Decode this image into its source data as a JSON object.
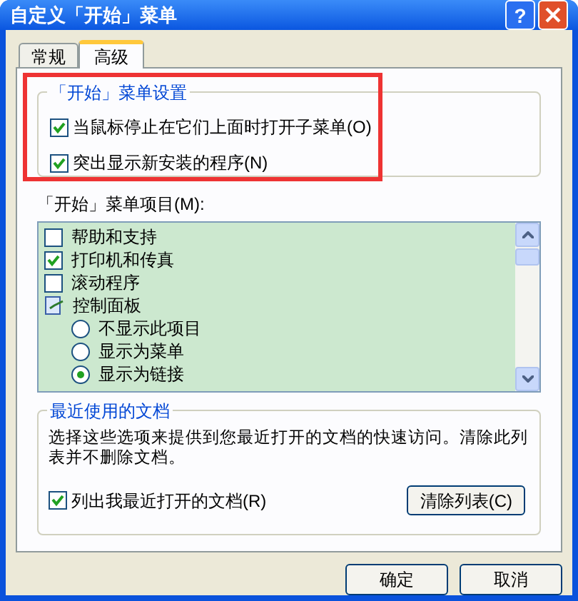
{
  "window": {
    "title": "自定义「开始」菜单",
    "help": "?"
  },
  "tabs": [
    {
      "label": "常规",
      "selected": false
    },
    {
      "label": "高级",
      "selected": true
    }
  ],
  "start_menu_settings": {
    "title": "「开始」菜单设置",
    "options": [
      {
        "label": "当鼠标停止在它们上面时打开子菜单(O)",
        "checked": true
      },
      {
        "label": "突出显示新安装的程序(N)",
        "checked": true
      }
    ]
  },
  "start_menu_items": {
    "label": "「开始」菜单项目(M):",
    "items": [
      {
        "kind": "checkbox",
        "label": "帮助和支持",
        "checked": false
      },
      {
        "kind": "checkbox",
        "label": "打印机和传真",
        "checked": true
      },
      {
        "kind": "checkbox",
        "label": "滚动程序",
        "checked": false
      },
      {
        "kind": "folder",
        "label": "控制面板",
        "children": [
          {
            "kind": "radio",
            "label": "不显示此项目",
            "selected": false
          },
          {
            "kind": "radio",
            "label": "显示为菜单",
            "selected": false
          },
          {
            "kind": "radio",
            "label": "显示为链接",
            "selected": true
          }
        ]
      }
    ]
  },
  "recent_documents": {
    "title": "最近使用的文档",
    "description": "选择这些选项来提供到您最近打开的文档的快速访问。清除此列表并不删除文档。",
    "option": {
      "label": "列出我最近打开的文档(R)",
      "checked": true
    },
    "clear_button": "清除列表(C)"
  },
  "buttons": [
    "确定",
    "取消"
  ]
}
